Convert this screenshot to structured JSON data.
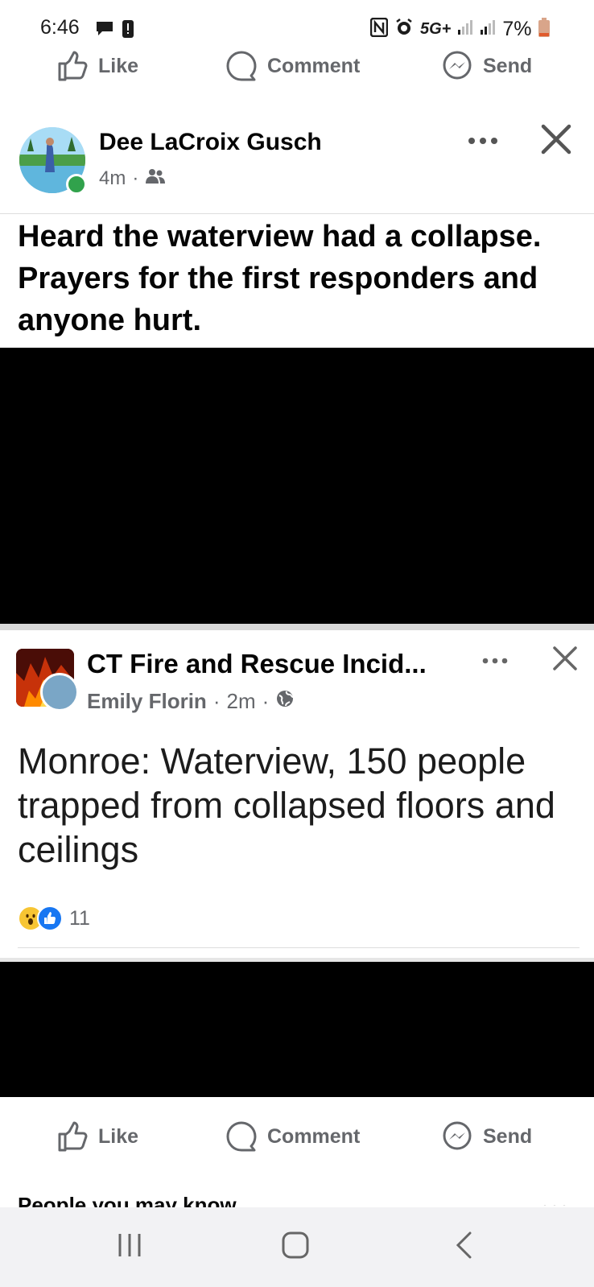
{
  "status_bar": {
    "time": "6:46",
    "network": "5G+",
    "battery": "7%"
  },
  "top_actions": {
    "like": "Like",
    "comment": "Comment",
    "send": "Send"
  },
  "post": {
    "author": "Dee LaCroix Gusch",
    "time": "4m",
    "separator": "·",
    "text": "Heard the waterview had a collapse. Prayers for the first responders and anyone hurt."
  },
  "shared_post": {
    "page_name": "CT Fire and Rescue Incid...",
    "poster": "Emily Florin",
    "separator": "·",
    "time": "2m",
    "text": "Monroe: Waterview, 150 people trapped from collapsed floors and ceilings",
    "reaction_count": "11"
  },
  "bottom_actions": {
    "like": "Like",
    "comment": "Comment",
    "send": "Send"
  },
  "footer": {
    "people_you_may_know": "People you may know"
  },
  "colors": {
    "accent": "#1877f2",
    "online": "#31a24c",
    "muted": "#65676b"
  }
}
